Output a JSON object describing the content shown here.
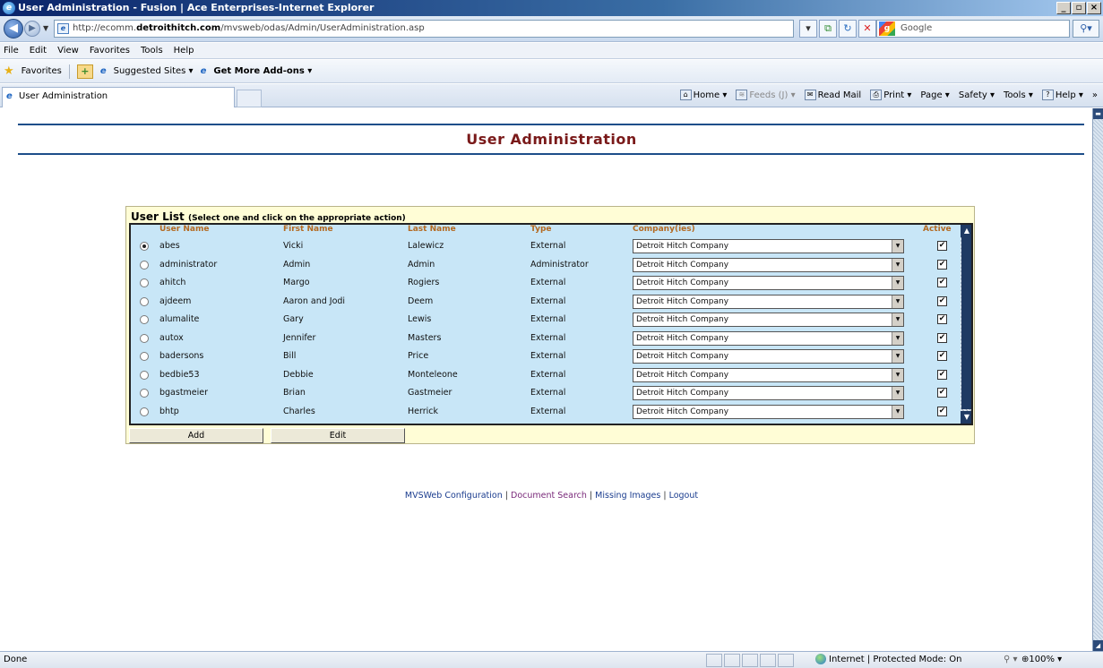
{
  "window": {
    "title": "User Administration - Fusion | Ace Enterprises-Internet Explorer",
    "controls": [
      "_",
      "▫",
      "×"
    ]
  },
  "address": {
    "url_prefix": "http://ecomm.",
    "url_domain": "detroithitch.com",
    "url_path": "/mvsweb/odas/Admin/UserAdministration.asp",
    "search_placeholder": "Google"
  },
  "menu": [
    "File",
    "Edit",
    "View",
    "Favorites",
    "Tools",
    "Help"
  ],
  "favorites_bar": {
    "favorites": "Favorites",
    "suggested": "Suggested Sites ▾",
    "addons": "Get More Add-ons ▾"
  },
  "tab": {
    "label": "User Administration"
  },
  "command_bar": {
    "home": "Home ▾",
    "feeds": "Feeds (J) ▾",
    "read_mail": "Read Mail",
    "print": "Print ▾",
    "page": "Page ▾",
    "safety": "Safety ▾",
    "tools": "Tools ▾",
    "help": "Help ▾",
    "more": "»"
  },
  "page": {
    "title": "User Administration",
    "panel_title": "User List",
    "panel_hint": "(Select one and click on the appropriate action)"
  },
  "columns": {
    "user_name": "User Name",
    "first_name": "First Name",
    "last_name": "Last Name",
    "type": "Type",
    "company": "Company(ies)",
    "active": "Active"
  },
  "users": [
    {
      "user": "abes",
      "first": "Vicki",
      "last": "Lalewicz",
      "type": "External",
      "company": "Detroit Hitch Company",
      "active": "✔",
      "selected": true
    },
    {
      "user": "administrator",
      "first": "Admin",
      "last": "Admin",
      "type": "Administrator",
      "company": "Detroit Hitch Company",
      "active": "✔",
      "selected": false
    },
    {
      "user": "ahitch",
      "first": "Margo",
      "last": "Rogiers",
      "type": "External",
      "company": "Detroit Hitch Company",
      "active": "✔",
      "selected": false
    },
    {
      "user": "ajdeem",
      "first": "Aaron and Jodi",
      "last": "Deem",
      "type": "External",
      "company": "Detroit Hitch Company",
      "active": "✔",
      "selected": false
    },
    {
      "user": "alumalite",
      "first": "Gary",
      "last": "Lewis",
      "type": "External",
      "company": "Detroit Hitch Company",
      "active": "✔",
      "selected": false
    },
    {
      "user": "autox",
      "first": "Jennifer",
      "last": "Masters",
      "type": "External",
      "company": "Detroit Hitch Company",
      "active": "✔",
      "selected": false
    },
    {
      "user": "badersons",
      "first": "Bill",
      "last": "Price",
      "type": "External",
      "company": "Detroit Hitch Company",
      "active": "✔",
      "selected": false
    },
    {
      "user": "bedbie53",
      "first": "Debbie",
      "last": "Monteleone",
      "type": "External",
      "company": "Detroit Hitch Company",
      "active": "✔",
      "selected": false
    },
    {
      "user": "bgastmeier",
      "first": "Brian",
      "last": "Gastmeier",
      "type": "External",
      "company": "Detroit Hitch Company",
      "active": "✔",
      "selected": false
    },
    {
      "user": "bhtp",
      "first": "Charles",
      "last": "Herrick",
      "type": "External",
      "company": "Detroit Hitch Company",
      "active": "✔",
      "selected": false
    }
  ],
  "buttons": {
    "add": "Add",
    "edit": "Edit"
  },
  "footer": {
    "config": "MVSWeb Configuration",
    "search": "Document Search",
    "missing": "Missing Images",
    "logout": "Logout",
    "sep": "|"
  },
  "status": {
    "text": "Done",
    "zone": "Internet | Protected Mode: On",
    "security": "⚲ ▾",
    "zoom": "⊕100% ▾"
  },
  "icons": {
    "back": "back-arrow-icon",
    "forward": "forward-arrow-icon",
    "refresh": "refresh-icon",
    "stop": "stop-icon",
    "search": "magnifier-icon",
    "favorites": "star-icon"
  }
}
